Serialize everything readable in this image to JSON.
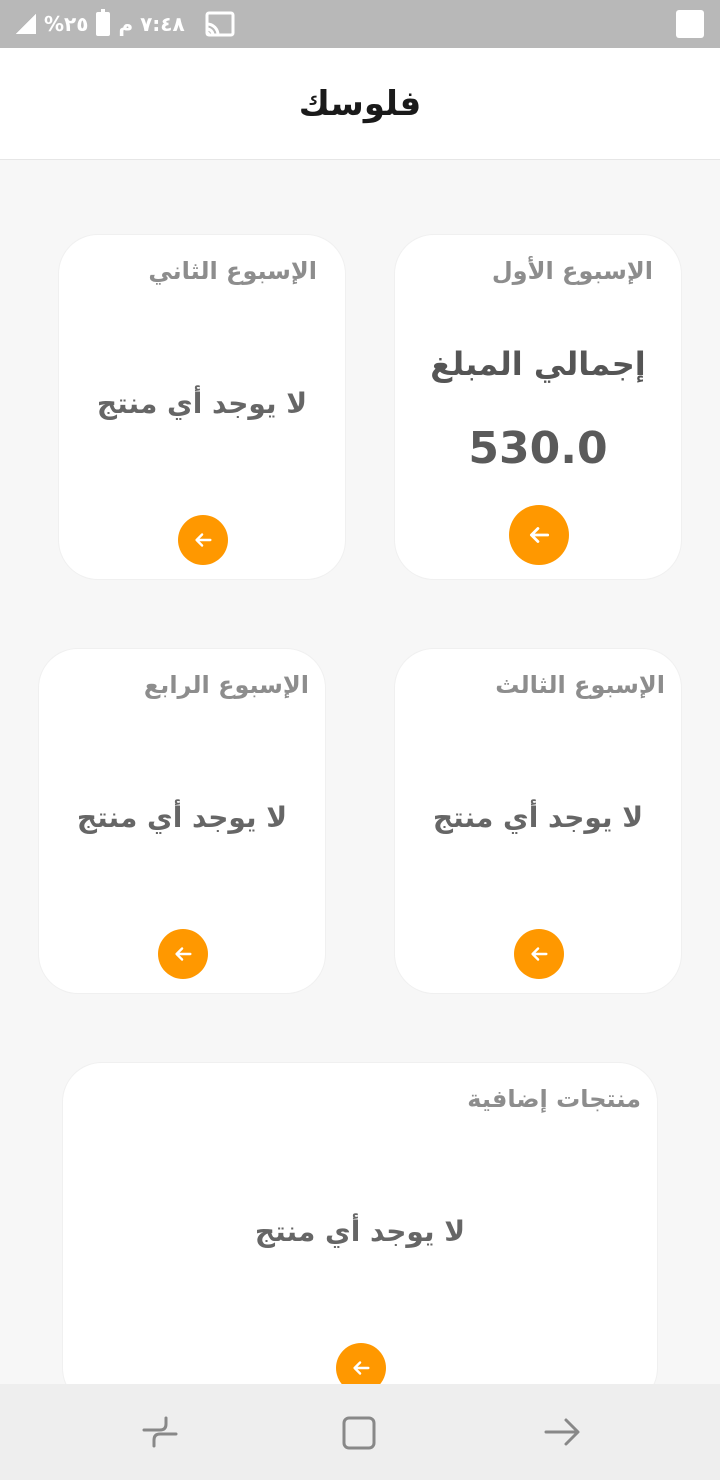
{
  "status_bar": {
    "time": "٧:٤٨ م",
    "battery": "٢٥%"
  },
  "app_bar": {
    "title": "فلوسك"
  },
  "cards": {
    "week1": {
      "title": "الإسبوع الأول",
      "total_label": "إجمالي المبلغ",
      "total_value": "530.0"
    },
    "week2": {
      "title": "الإسبوع الثاني",
      "empty_text": "لا يوجد أي منتج"
    },
    "week3": {
      "title": "الإسبوع الثالث",
      "empty_text": "لا يوجد أي منتج"
    },
    "week4": {
      "title": "الإسبوع الرابع",
      "empty_text": "لا يوجد أي منتج"
    },
    "extra": {
      "title": "منتجات إضافية",
      "empty_text": "لا يوجد أي منتج"
    }
  },
  "colors": {
    "accent": "#ff9800",
    "card_bg": "#ffffff",
    "page_bg": "#f7f7f7",
    "status_bar": "#b8b8b8"
  },
  "icons": {
    "card_button": "arrow-left-icon",
    "nav_recents": "recents-icon",
    "nav_home": "home-icon",
    "nav_back": "back-icon"
  }
}
